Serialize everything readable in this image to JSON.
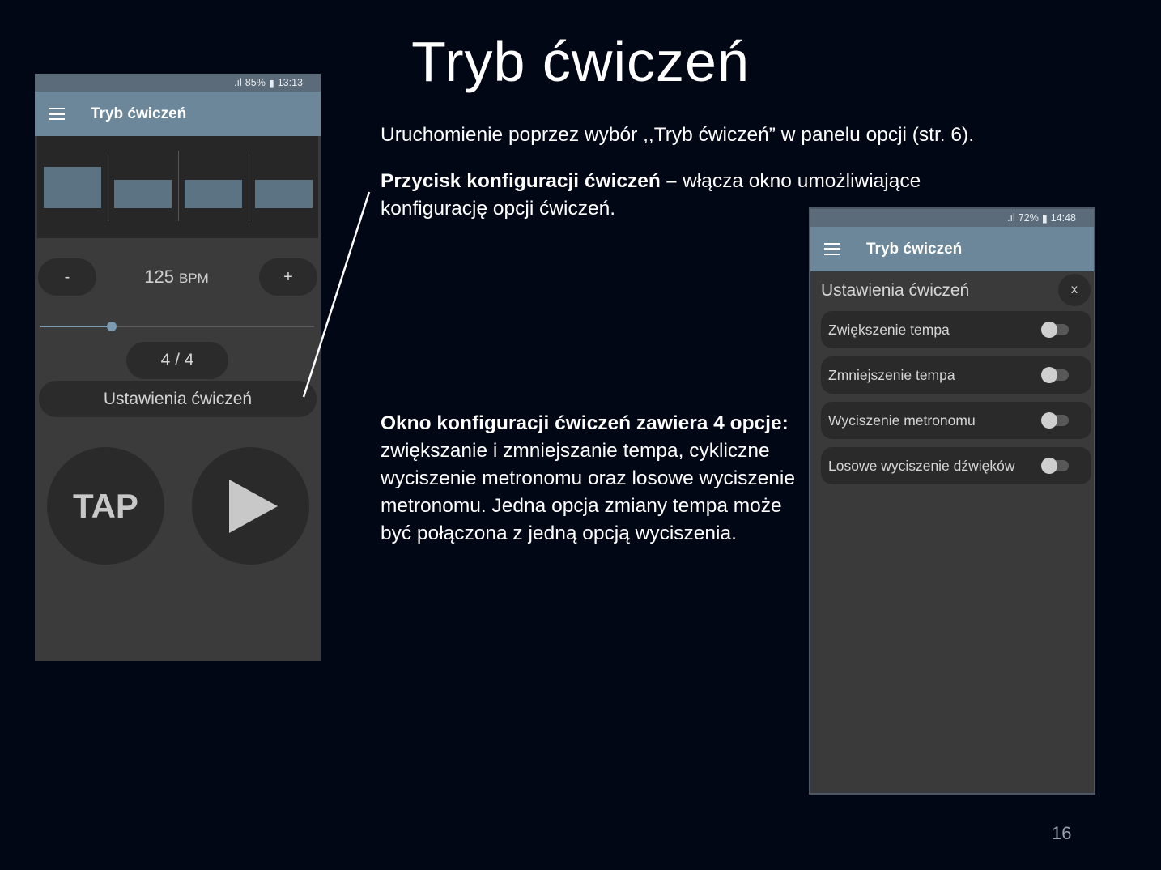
{
  "slide": {
    "title": "Tryb ćwiczeń",
    "paragraph1": "Uruchomienie poprzez wybór ,,Tryb ćwiczeń” w panelu opcji (str. 6).",
    "paragraph2_bold": "Przycisk konfiguracji ćwiczeń –",
    "paragraph2_rest": " włącza okno umożliwiające konfigurację opcji ćwiczeń.",
    "paragraph3_bold": "Okno konfiguracji ćwiczeń zawiera 4 opcje:",
    "paragraph3_rest": " zwiększanie i zmniejszanie tempa, cykliczne wyciszenie metronomu oraz losowe wyciszenie metronomu. Jedna opcja zmiany tempa może być połączona z jedną opcją wyciszenia.",
    "page_number": "16"
  },
  "phone1": {
    "status": {
      "battery": "85%",
      "time": "13:13"
    },
    "app_title": "Tryb ćwiczeń",
    "minus_label": "-",
    "plus_label": "+",
    "bpm_value": "125",
    "bpm_unit": "BPM",
    "tempo_slider_fraction": 0.26,
    "meter": "4 / 4",
    "settings_button": "Ustawienia ćwiczeń",
    "tap_label": "TAP"
  },
  "phone2": {
    "status": {
      "battery": "72%",
      "time": "14:48"
    },
    "app_title": "Tryb ćwiczeń",
    "dialog_title": "Ustawienia ćwiczeń",
    "close_label": "x",
    "options": [
      {
        "label": "Zwiększenie tempa",
        "enabled": false
      },
      {
        "label": "Zmniejszenie tempa",
        "enabled": false
      },
      {
        "label": "Wyciszenie metronomu",
        "enabled": false
      },
      {
        "label": "Losowe wyciszenie dźwięków",
        "enabled": false
      }
    ]
  },
  "colors": {
    "background": "#020716",
    "app_bar": "#6c8799",
    "accent": "#7c9bb0"
  }
}
